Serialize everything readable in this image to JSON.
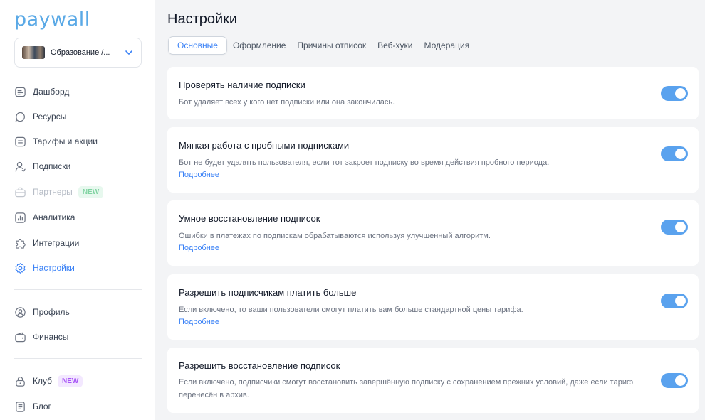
{
  "brand": {
    "logo": "paywall"
  },
  "project": {
    "name": "Образование /..."
  },
  "nav": {
    "dashboard": "Дашборд",
    "resources": "Ресурсы",
    "tariffs": "Тарифы и акции",
    "subscriptions": "Подписки",
    "partners": "Партнеры",
    "partners_badge": "NEW",
    "analytics": "Аналитика",
    "integrations": "Интеграции",
    "settings": "Настройки",
    "profile": "Профиль",
    "finance": "Финансы",
    "club": "Клуб",
    "club_badge": "NEW",
    "blog": "Блог"
  },
  "page": {
    "title": "Настройки"
  },
  "tabs": [
    {
      "label": "Основные"
    },
    {
      "label": "Оформление"
    },
    {
      "label": "Причины отписок"
    },
    {
      "label": "Веб-хуки"
    },
    {
      "label": "Модерация"
    }
  ],
  "settings": [
    {
      "title": "Проверять наличие подписки",
      "description": "Бот удаляет всех у кого нет подписки или она закончилась.",
      "enabled": true
    },
    {
      "title": "Мягкая работа с пробными подписками",
      "description": "Бот не будет удалять пользователя, если тот закроет подписку во время действия пробного периода.",
      "more": "Подробнее",
      "enabled": true
    },
    {
      "title": "Умное восстановление подписок",
      "description": "Ошибки в платежах по подпискам обрабатываются используя улучшенный алгоритм.",
      "more": "Подробнее",
      "enabled": true
    },
    {
      "title": "Разрешить подписчикам платить больше",
      "description": "Если включено, то ваши пользователи смогут платить вам больше стандартной цены тарифа.",
      "more": "Подробнее",
      "enabled": true
    },
    {
      "title": "Разрешить восстановление подписок",
      "description": "Если включено, подписчики смогут восстановить завершённую подписку с сохранением прежних условий, даже если тариф перенесён в архив.",
      "enabled": true
    }
  ],
  "colors": {
    "accent": "#3b82f6",
    "toggle_on": "#5aa2ee",
    "logo": "#5aa9e6"
  }
}
